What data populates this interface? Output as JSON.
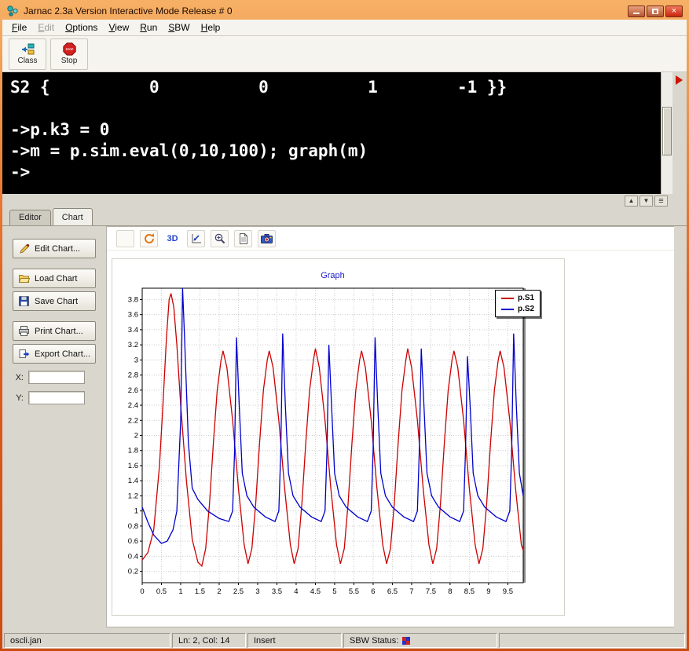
{
  "window": {
    "title": "Jarnac 2.3a Version Interactive Mode Release # 0"
  },
  "menu": {
    "items": [
      {
        "label": "File",
        "enabled": true
      },
      {
        "label": "Edit",
        "enabled": false
      },
      {
        "label": "Options",
        "enabled": true
      },
      {
        "label": "View",
        "enabled": true
      },
      {
        "label": "Run",
        "enabled": true
      },
      {
        "label": "SBW",
        "enabled": true
      },
      {
        "label": "Help",
        "enabled": true
      }
    ]
  },
  "toolbar": {
    "class_label": "Class",
    "stop_label": "Stop"
  },
  "console": {
    "lines": [
      "S2 {          0          0          1        -1 }}",
      "",
      "->p.k3 = 0",
      "->m = p.sim.eval(0,10,100); graph(m)",
      "->"
    ]
  },
  "tabs": {
    "editor": "Editor",
    "chart": "Chart"
  },
  "sidebar": {
    "edit": "Edit Chart...",
    "load": "Load Chart",
    "save": "Save Chart",
    "print": "Print Chart...",
    "export": "Export Chart...",
    "x_label": "X:",
    "y_label": "Y:",
    "x_value": "",
    "y_value": ""
  },
  "chart_toolbar": {
    "threed_label": "3D"
  },
  "chart_data": {
    "type": "line",
    "title": "Graph",
    "title_color": "#2222cc",
    "xlabel": "",
    "ylabel": "",
    "xlim": [
      0,
      9.9
    ],
    "ylim": [
      0.05,
      3.95
    ],
    "grid": true,
    "legend_position": "top-right",
    "xticks": [
      "0",
      "0.5",
      "1",
      "1.5",
      "2",
      "2.5",
      "3",
      "3.5",
      "4",
      "4.5",
      "5",
      "5.5",
      "6",
      "6.5",
      "7",
      "7.5",
      "8",
      "8.5",
      "9",
      "9.5"
    ],
    "yticks": [
      "0.2",
      "0.4",
      "0.6",
      "0.8",
      "1",
      "1.2",
      "1.4",
      "1.6",
      "1.8",
      "2",
      "2.2",
      "2.4",
      "2.6",
      "2.8",
      "3",
      "3.2",
      "3.4",
      "3.6",
      "3.8"
    ],
    "series": [
      {
        "name": "p.S1",
        "color": "#cc0000",
        "points": [
          [
            0,
            0.35
          ],
          [
            0.15,
            0.45
          ],
          [
            0.3,
            0.75
          ],
          [
            0.45,
            1.6
          ],
          [
            0.55,
            2.5
          ],
          [
            0.63,
            3.3
          ],
          [
            0.7,
            3.8
          ],
          [
            0.75,
            3.88
          ],
          [
            0.82,
            3.7
          ],
          [
            0.9,
            3.2
          ],
          [
            1.0,
            2.4
          ],
          [
            1.15,
            1.4
          ],
          [
            1.3,
            0.62
          ],
          [
            1.45,
            0.32
          ],
          [
            1.55,
            0.27
          ],
          [
            1.65,
            0.5
          ],
          [
            1.75,
            1.1
          ],
          [
            1.85,
            1.9
          ],
          [
            1.95,
            2.6
          ],
          [
            2.05,
            3.0
          ],
          [
            2.1,
            3.12
          ],
          [
            2.2,
            2.9
          ],
          [
            2.35,
            2.2
          ],
          [
            2.5,
            1.3
          ],
          [
            2.65,
            0.55
          ],
          [
            2.75,
            0.3
          ],
          [
            2.85,
            0.5
          ],
          [
            2.95,
            1.1
          ],
          [
            3.05,
            1.9
          ],
          [
            3.15,
            2.6
          ],
          [
            3.25,
            3.0
          ],
          [
            3.3,
            3.12
          ],
          [
            3.4,
            2.9
          ],
          [
            3.55,
            2.2
          ],
          [
            3.7,
            1.3
          ],
          [
            3.85,
            0.55
          ],
          [
            3.95,
            0.3
          ],
          [
            4.05,
            0.5
          ],
          [
            4.15,
            1.1
          ],
          [
            4.25,
            1.9
          ],
          [
            4.35,
            2.6
          ],
          [
            4.45,
            3.0
          ],
          [
            4.5,
            3.15
          ],
          [
            4.6,
            2.9
          ],
          [
            4.75,
            2.2
          ],
          [
            4.9,
            1.3
          ],
          [
            5.05,
            0.55
          ],
          [
            5.15,
            0.3
          ],
          [
            5.25,
            0.5
          ],
          [
            5.35,
            1.1
          ],
          [
            5.45,
            1.9
          ],
          [
            5.55,
            2.6
          ],
          [
            5.65,
            3.0
          ],
          [
            5.7,
            3.12
          ],
          [
            5.8,
            2.9
          ],
          [
            5.95,
            2.2
          ],
          [
            6.1,
            1.3
          ],
          [
            6.25,
            0.55
          ],
          [
            6.35,
            0.3
          ],
          [
            6.45,
            0.5
          ],
          [
            6.55,
            1.1
          ],
          [
            6.65,
            1.9
          ],
          [
            6.75,
            2.6
          ],
          [
            6.85,
            3.0
          ],
          [
            6.9,
            3.15
          ],
          [
            7.0,
            2.9
          ],
          [
            7.15,
            2.2
          ],
          [
            7.3,
            1.3
          ],
          [
            7.45,
            0.55
          ],
          [
            7.55,
            0.3
          ],
          [
            7.65,
            0.5
          ],
          [
            7.75,
            1.1
          ],
          [
            7.85,
            1.9
          ],
          [
            7.95,
            2.6
          ],
          [
            8.05,
            3.0
          ],
          [
            8.1,
            3.12
          ],
          [
            8.2,
            2.9
          ],
          [
            8.35,
            2.2
          ],
          [
            8.5,
            1.3
          ],
          [
            8.65,
            0.55
          ],
          [
            8.75,
            0.3
          ],
          [
            8.85,
            0.5
          ],
          [
            8.95,
            1.1
          ],
          [
            9.05,
            1.9
          ],
          [
            9.15,
            2.6
          ],
          [
            9.25,
            3.0
          ],
          [
            9.3,
            3.12
          ],
          [
            9.4,
            2.9
          ],
          [
            9.55,
            2.2
          ],
          [
            9.7,
            1.3
          ],
          [
            9.85,
            0.55
          ],
          [
            9.9,
            0.48
          ]
        ]
      },
      {
        "name": "p.S2",
        "color": "#0000cc",
        "points": [
          [
            0,
            1.05
          ],
          [
            0.15,
            0.85
          ],
          [
            0.3,
            0.68
          ],
          [
            0.5,
            0.57
          ],
          [
            0.65,
            0.6
          ],
          [
            0.8,
            0.75
          ],
          [
            0.9,
            1.0
          ],
          [
            1.0,
            2.2
          ],
          [
            1.05,
            3.95
          ],
          [
            1.1,
            3.3
          ],
          [
            1.2,
            1.9
          ],
          [
            1.3,
            1.3
          ],
          [
            1.45,
            1.15
          ],
          [
            1.7,
            1.0
          ],
          [
            2.0,
            0.9
          ],
          [
            2.25,
            0.86
          ],
          [
            2.35,
            1.0
          ],
          [
            2.4,
            1.8
          ],
          [
            2.45,
            3.3
          ],
          [
            2.52,
            2.4
          ],
          [
            2.6,
            1.5
          ],
          [
            2.72,
            1.2
          ],
          [
            2.9,
            1.05
          ],
          [
            3.2,
            0.92
          ],
          [
            3.45,
            0.86
          ],
          [
            3.55,
            1.0
          ],
          [
            3.6,
            1.8
          ],
          [
            3.65,
            3.35
          ],
          [
            3.72,
            2.4
          ],
          [
            3.8,
            1.5
          ],
          [
            3.92,
            1.2
          ],
          [
            4.1,
            1.05
          ],
          [
            4.4,
            0.92
          ],
          [
            4.65,
            0.86
          ],
          [
            4.75,
            1.0
          ],
          [
            4.8,
            1.8
          ],
          [
            4.85,
            3.2
          ],
          [
            4.92,
            2.4
          ],
          [
            5.0,
            1.5
          ],
          [
            5.12,
            1.2
          ],
          [
            5.3,
            1.05
          ],
          [
            5.6,
            0.92
          ],
          [
            5.85,
            0.86
          ],
          [
            5.95,
            1.0
          ],
          [
            6.0,
            1.8
          ],
          [
            6.05,
            3.3
          ],
          [
            6.12,
            2.4
          ],
          [
            6.2,
            1.5
          ],
          [
            6.32,
            1.2
          ],
          [
            6.5,
            1.05
          ],
          [
            6.8,
            0.92
          ],
          [
            7.05,
            0.86
          ],
          [
            7.15,
            1.0
          ],
          [
            7.2,
            1.8
          ],
          [
            7.25,
            3.15
          ],
          [
            7.32,
            2.4
          ],
          [
            7.4,
            1.5
          ],
          [
            7.52,
            1.2
          ],
          [
            7.7,
            1.05
          ],
          [
            8.0,
            0.92
          ],
          [
            8.25,
            0.86
          ],
          [
            8.35,
            1.0
          ],
          [
            8.4,
            1.8
          ],
          [
            8.45,
            3.05
          ],
          [
            8.52,
            2.4
          ],
          [
            8.6,
            1.5
          ],
          [
            8.72,
            1.2
          ],
          [
            8.9,
            1.05
          ],
          [
            9.2,
            0.92
          ],
          [
            9.45,
            0.86
          ],
          [
            9.55,
            1.0
          ],
          [
            9.6,
            1.8
          ],
          [
            9.65,
            3.35
          ],
          [
            9.72,
            2.4
          ],
          [
            9.8,
            1.5
          ],
          [
            9.9,
            1.2
          ]
        ]
      }
    ]
  },
  "statusbar": {
    "file": "oscli.jan",
    "position": "Ln: 2, Col: 14",
    "mode": "Insert",
    "sbw": "SBW Status:"
  }
}
